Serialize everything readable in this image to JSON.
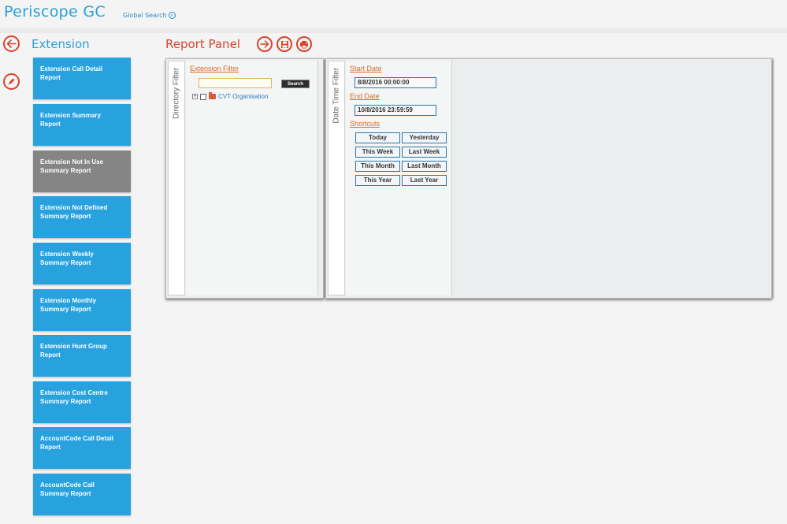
{
  "header": {
    "app_title": "Periscope GC",
    "global_search_label": "Global Search"
  },
  "sidebar": {
    "section_title": "Extension",
    "tiles": [
      {
        "line1": "Extension Call Detail",
        "line2": "Report",
        "selected": false
      },
      {
        "line1": "Extension Summary",
        "line2": "Report",
        "selected": false
      },
      {
        "line1": "Extension Not In Use",
        "line2": "Summary Report",
        "selected": true
      },
      {
        "line1": "Extension Not Defined",
        "line2": "Summary Report",
        "selected": false
      },
      {
        "line1": "Extension Weekly",
        "line2": "Summary Report",
        "selected": false
      },
      {
        "line1": "Extension Monthly",
        "line2": "Summary Report",
        "selected": false
      },
      {
        "line1": "Extension Hunt Group",
        "line2": "Report",
        "selected": false
      },
      {
        "line1": "Extension Cost Centre",
        "line2": "Summary Report",
        "selected": false
      },
      {
        "line1": "AccountCode Call Detail",
        "line2": "Report",
        "selected": false
      },
      {
        "line1": "AccountCode Call",
        "line2": "Summary Report",
        "selected": false
      }
    ]
  },
  "report_panel": {
    "title": "Report Panel",
    "icons": [
      "run-arrow-icon",
      "save-disk-icon",
      "print-icon"
    ]
  },
  "directory_filter": {
    "tab_label": "Directory Filter",
    "filter_link": "Extension Filter",
    "search_input_value": "",
    "search_button_label": "Search",
    "tree": [
      {
        "expander": "+",
        "label": "CVT Organisation",
        "checked": false
      }
    ]
  },
  "datetime_filter": {
    "tab_label": "Date Time Filter",
    "start_label": "Start Date",
    "start_value": "8/8/2016 00:00:00",
    "end_label": "End Date",
    "end_value": "10/8/2016 23:59:59",
    "shortcuts_label": "Shortcuts",
    "shortcuts": [
      [
        "Today",
        "Yesterday"
      ],
      [
        "This Week",
        "Last Week"
      ],
      [
        "This Month",
        "Last Month"
      ],
      [
        "This Year",
        "Last Year"
      ]
    ]
  },
  "colors": {
    "brand_blue": "#2aa0d8",
    "accent_red": "#d9442c",
    "tile_blue": "#27a2df",
    "tile_selected": "#858585",
    "link_orange": "#d66d2d"
  }
}
